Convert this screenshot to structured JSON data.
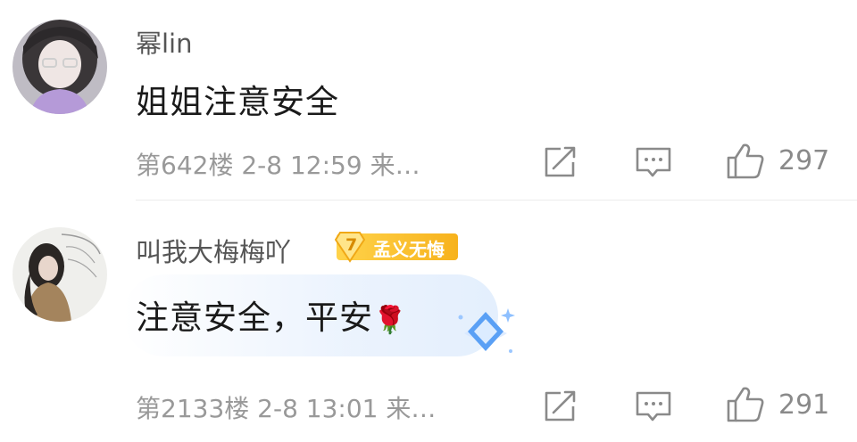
{
  "comments": [
    {
      "username": "幂lin",
      "text": "姐姐注意安全",
      "meta": "第642楼  2-8 12:59  来…",
      "likes": "297"
    },
    {
      "username": "叫我大梅梅吖",
      "badge": {
        "level": "7",
        "label": "孟义无悔"
      },
      "text": "注意安全，平安",
      "emoji": "🌹",
      "meta": "第2133楼  2-8 13:01  来…",
      "likes": "291"
    }
  ],
  "icons": {
    "share": "share-icon",
    "reply": "comment-icon",
    "like": "thumbs-up-icon"
  },
  "colors": {
    "badge_gold": "#f7b21c",
    "meta_gray": "#999999",
    "bubble_blue": "#e2eefd"
  }
}
